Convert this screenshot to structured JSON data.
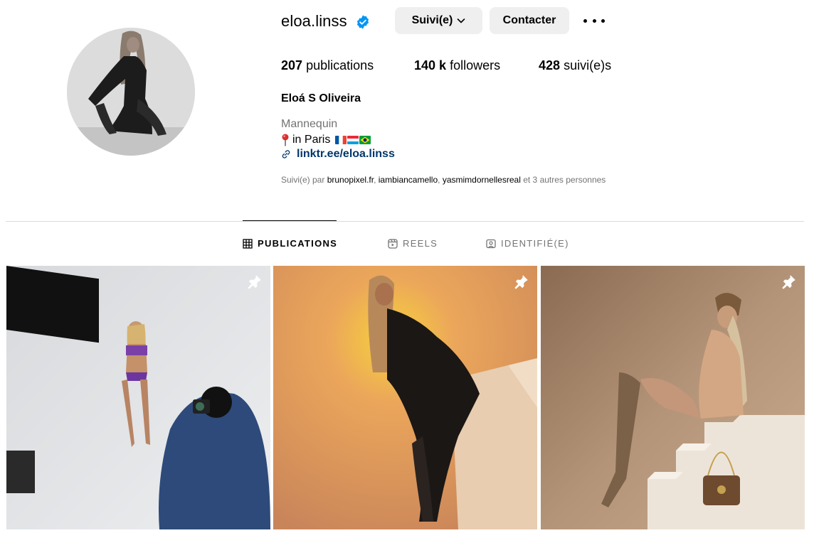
{
  "profile": {
    "username": "eloa.linss",
    "verified": true,
    "full_name": "Eloá S Oliveira",
    "category": "Mannequin",
    "location_text": "in Paris",
    "flags": [
      "france",
      "luxembourg",
      "brazil"
    ],
    "link": "linktr.ee/eloa.linss"
  },
  "buttons": {
    "follow_label": "Suivi(e)",
    "contact_label": "Contacter",
    "more_icon": "more-horizontal-icon"
  },
  "stats": {
    "posts_count": "207",
    "posts_label": "publications",
    "followers_count": "140 k",
    "followers_label": "followers",
    "following_count": "428",
    "following_label": "suivi(e)s"
  },
  "followed_by": {
    "prefix": "Suivi(e) par",
    "accounts": [
      "brunopixel.fr",
      "iambiancamello",
      "yasmimdornellesreal"
    ],
    "suffix": "et 3 autres personnes"
  },
  "tabs": [
    {
      "label": "PUBLICATIONS",
      "icon": "grid-icon",
      "active": true
    },
    {
      "label": "REELS",
      "icon": "reels-icon",
      "active": false
    },
    {
      "label": "IDENTIFIÉ(E)",
      "icon": "tagged-icon",
      "active": false
    }
  ],
  "posts": [
    {
      "pinned": true
    },
    {
      "pinned": true
    },
    {
      "pinned": true
    }
  ],
  "colors": {
    "button_bg": "#efefef",
    "link": "#00376b",
    "verified": "#0095f6",
    "muted": "#737373"
  }
}
